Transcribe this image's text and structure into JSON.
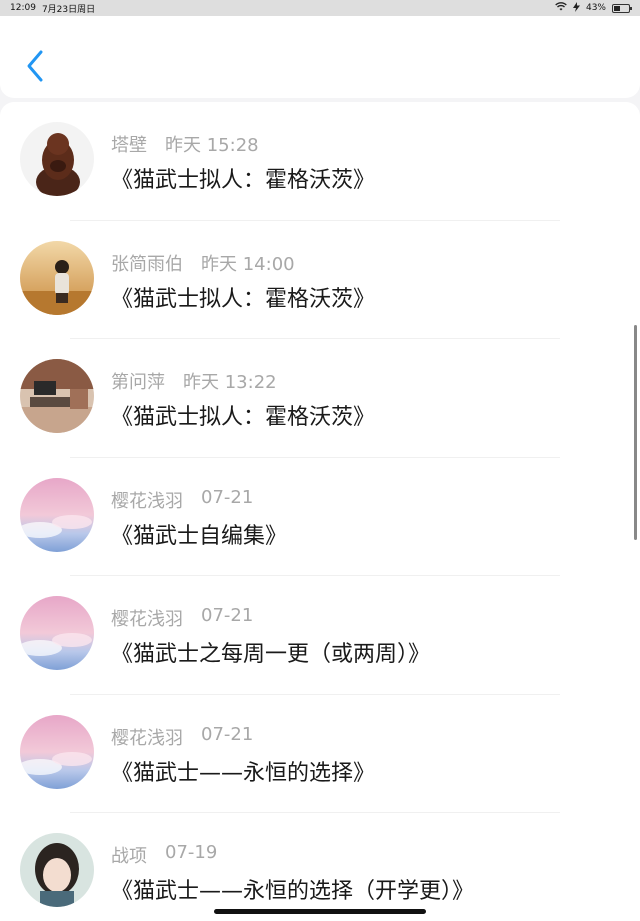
{
  "status_bar": {
    "time": "12:09",
    "date": "7月23日周日",
    "battery_percent": "43%",
    "battery_level": 0.43,
    "icons": [
      "wifi-icon",
      "charging-icon",
      "battery-icon"
    ]
  },
  "header": {
    "back_icon": "chevron-left-icon",
    "accent_color": "#2196f3"
  },
  "items": [
    {
      "name": "塔壁",
      "time": "昨天 15:28",
      "title": "《猫武士拟人：霍格沃茨》",
      "avatar": "statue"
    },
    {
      "name": "张简雨伯",
      "time": "昨天 14:00",
      "title": "《猫武士拟人：霍格沃茨》",
      "avatar": "autumn"
    },
    {
      "name": "第问萍",
      "time": "昨天 13:22",
      "title": "《猫武士拟人：霍格沃茨》",
      "avatar": "room"
    },
    {
      "name": "樱花浅羽",
      "time": "07-21",
      "title": "《猫武士自编集》",
      "avatar": "sky"
    },
    {
      "name": "樱花浅羽",
      "time": "07-21",
      "title": "《猫武士之每周一更（或两周）》",
      "avatar": "sky"
    },
    {
      "name": "樱花浅羽",
      "time": "07-21",
      "title": "《猫武士——永恒的选择》",
      "avatar": "sky"
    },
    {
      "name": "战项",
      "time": "07-19",
      "title": "《猫武士——永恒的选择（开学更）》",
      "avatar": "portrait"
    }
  ]
}
